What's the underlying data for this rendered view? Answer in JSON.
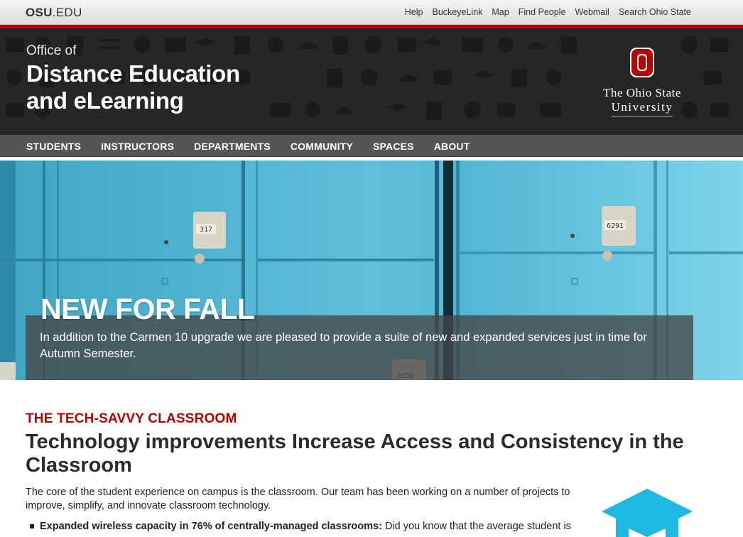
{
  "osu_bar": {
    "logo_bold": "OSU",
    "logo_rest": ".EDU",
    "links": [
      "Help",
      "BuckeyeLink",
      "Map",
      "Find People",
      "Webmail",
      "Search Ohio State"
    ]
  },
  "masthead": {
    "pre_title": "Office of",
    "title_line1": "Distance Education",
    "title_line2": "and eLearning",
    "brand_line1": "The Ohio State",
    "brand_line2": "University"
  },
  "nav": {
    "items": [
      "STUDENTS",
      "INSTRUCTORS",
      "DEPARTMENTS",
      "COMMUNITY",
      "SPACES",
      "ABOUT"
    ]
  },
  "hero": {
    "heading": "NEW FOR FALL",
    "text": "In addition to the Carmen 10 upgrade we are pleased to provide a suite of new and expanded services just in time for Autumn Semester.",
    "locker_numbers": [
      "317",
      "6291",
      "6750"
    ]
  },
  "article": {
    "kicker": "THE TECH-SAVVY CLASSROOM",
    "headline": "Technology improvements Increase Access and Consistency in the Classroom",
    "intro": "The core of the student experience on campus is the classroom.  Our team has been working on a number of projects to improve, simplify, and innovate classroom technology.",
    "bullet_bold": "Expanded wireless capacity in 76% of centrally-managed classrooms:",
    "bullet_text": " Did you know that the average student is"
  },
  "colors": {
    "accent_red": "#bb0000",
    "masthead_bg": "#262626",
    "nav_bg": "#555555",
    "locker_blue": "#4db3cf",
    "icon_cyan": "#1fb8e0"
  }
}
